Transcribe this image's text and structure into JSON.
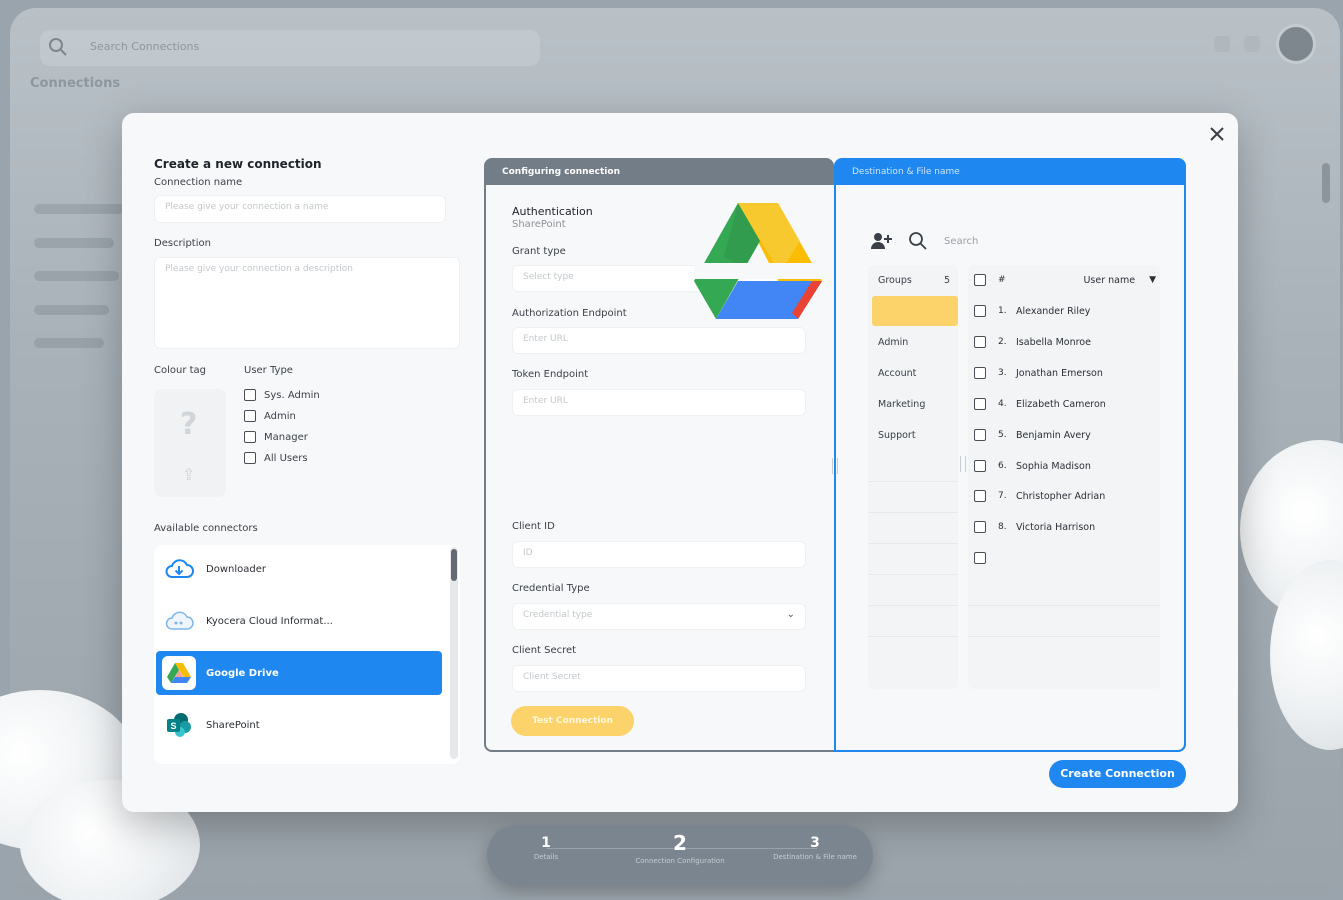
{
  "background": {
    "search_placeholder": "Search Connections",
    "page_title": "Connections"
  },
  "modal": {
    "title": "Create a new connection",
    "connection_name_label": "Connection name",
    "connection_name_placeholder": "Please give your connection a name",
    "description_label": "Description",
    "description_placeholder": "Please give your connection a description",
    "colour_tag_label": "Colour tag",
    "user_type_label": "User Type",
    "user_types": [
      {
        "label": "Sys. Admin",
        "checked": false
      },
      {
        "label": "Admin",
        "checked": false
      },
      {
        "label": "Manager",
        "checked": false
      },
      {
        "label": "All Users",
        "checked": false
      }
    ],
    "available_connectors_label": "Available connectors",
    "connectors": [
      {
        "label": "Downloader",
        "icon": "cloud-download-icon",
        "selected": false
      },
      {
        "label": "Kyocera Cloud Informat...",
        "icon": "kyocera-cloud-icon",
        "selected": false
      },
      {
        "label": "Google Drive",
        "icon": "google-drive-icon",
        "selected": true
      },
      {
        "label": "SharePoint",
        "icon": "sharepoint-icon",
        "selected": false
      }
    ],
    "create_button": "Create Connection"
  },
  "config": {
    "tab_label": "Configuring connection",
    "auth_title": "Authentication",
    "auth_subtitle": "SharePoint",
    "grant_type_label": "Grant type",
    "grant_type_placeholder": "Select type",
    "auth_endpoint_label": "Authorization Endpoint",
    "auth_endpoint_placeholder": "Enter URL",
    "token_endpoint_label": "Token Endpoint",
    "token_endpoint_placeholder": "Enter URL",
    "client_id_label": "Client ID",
    "client_id_placeholder": "ID",
    "credential_type_label": "Credential Type",
    "credential_type_placeholder": "Credential type",
    "client_secret_label": "Client Secret",
    "client_secret_placeholder": "Client Secret",
    "test_button": "Test Connection"
  },
  "destination": {
    "tab_label": "Destination & File name",
    "search_placeholder": "Search",
    "groups_header": "Groups",
    "groups_count": "5",
    "groups": [
      "",
      "Admin",
      "Account",
      "Marketing",
      "Support"
    ],
    "users_header_num": "#",
    "users_header_name": "User name",
    "users": [
      {
        "num": "1.",
        "name": "Alexander Riley"
      },
      {
        "num": "2.",
        "name": "Isabella Monroe"
      },
      {
        "num": "3.",
        "name": "Jonathan Emerson"
      },
      {
        "num": "4.",
        "name": "Elizabeth Cameron"
      },
      {
        "num": "5.",
        "name": "Benjamin Avery"
      },
      {
        "num": "6.",
        "name": "Sophia Madison"
      },
      {
        "num": "7.",
        "name": "Christopher Adrian"
      },
      {
        "num": "8.",
        "name": "Victoria Harrison"
      }
    ]
  },
  "stepper": {
    "steps": [
      {
        "num": "1",
        "label": "Details"
      },
      {
        "num": "2",
        "label": "Connection Configuration"
      },
      {
        "num": "3",
        "label": "Destination & File name"
      }
    ],
    "active_step": 2
  },
  "colors": {
    "accent_blue": "#1e88f0",
    "accent_yellow": "#fbd36a",
    "panel_gray": "#737d87"
  }
}
